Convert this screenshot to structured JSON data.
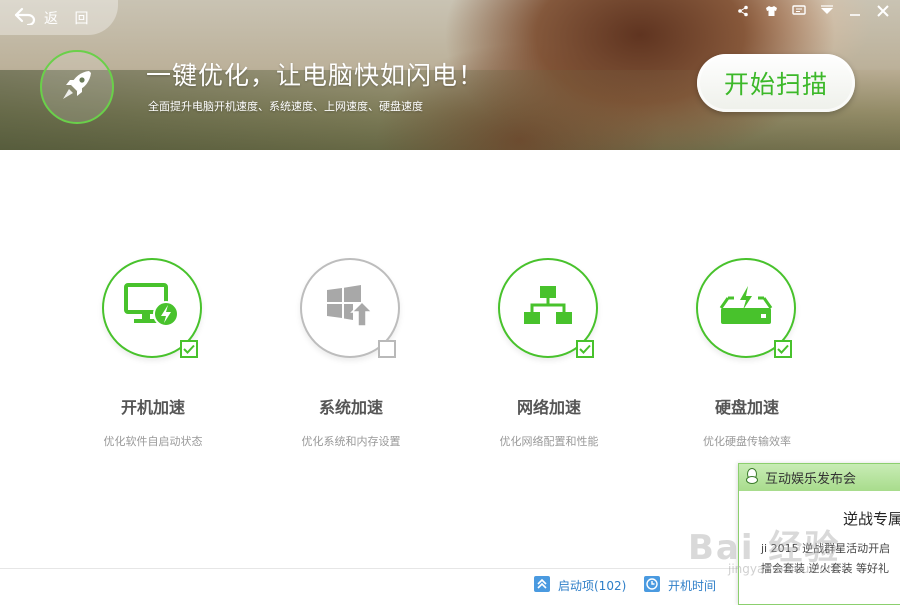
{
  "header": {
    "back_label": "返 回",
    "headline": "一键优化，让电脑快如闪电！",
    "subline": "全面提升电脑开机速度、系统速度、上网速度、硬盘速度",
    "scan_button": "开始扫描"
  },
  "window_icons": [
    "share-icon",
    "skin-icon",
    "message-icon",
    "menu-icon",
    "minimize-icon",
    "close-icon"
  ],
  "features": [
    {
      "title": "开机加速",
      "desc": "优化软件自启动状态",
      "checked": true,
      "icon": "monitor-bolt-icon"
    },
    {
      "title": "系统加速",
      "desc": "优化系统和内存设置",
      "checked": false,
      "icon": "windows-upgrade-icon"
    },
    {
      "title": "网络加速",
      "desc": "优化网络配置和性能",
      "checked": true,
      "icon": "network-icon"
    },
    {
      "title": "硬盘加速",
      "desc": "优化硬盘传输效率",
      "checked": true,
      "icon": "disk-bolt-icon"
    }
  ],
  "bottom": {
    "startup_items": "启动项(102)",
    "boot_time": "开机时间"
  },
  "popup": {
    "header": "互动娱乐发布会",
    "title": "逆战专属",
    "line1": "ji 2015 逆战群星活动开启",
    "line2": "擂会套装 逆火套装 等好礼"
  },
  "watermark": {
    "text": "Bai 经验",
    "url": "jingyan.baidu.com"
  },
  "colors": {
    "accent_green": "#48c22c",
    "link_blue": "#2f7fc8",
    "disabled_gray": "#bdbdbd"
  }
}
